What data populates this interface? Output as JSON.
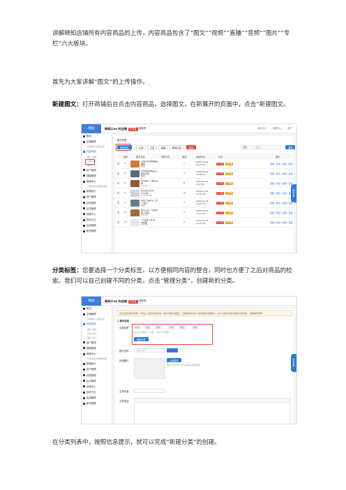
{
  "doc": {
    "p1": "讲解晓知店铺所有内容商品的上传，内容商品包含了“图文”“视频”“直播”“音频”“图片”“专栏”六大板块。",
    "p2": "首先为大家讲解“图文”的上传操作。",
    "p3_bold": "新建图文：",
    "p3": "打开商铺后台点击内容商品，选择图文，在新展开的页面中，点击“新建图文。",
    "p4_bold": "分类标签：",
    "p4": "您要选择一个分类标签，以方便相同内容的整合，同时也方便了之后对商品的检索。我们可以自己创建不同的分类，点击“管理分类”，创建新的分类。",
    "p5": "在分类列表中，按照信息提示，就可以完成“新建分类”的创建。"
  },
  "shot1": {
    "logo": "晓知",
    "shop": "晓知Live 的店铺",
    "tag": "已认证",
    "topmid": "店铺管理",
    "topright": [
      "消息中心",
      "帮助中心",
      "账户"
    ],
    "sidebar": [
      {
        "label": "概况",
        "type": "main"
      },
      {
        "label": "店铺管理",
        "type": "main"
      },
      {
        "label": "店铺装修  店铺设置",
        "type": "sub"
      },
      {
        "label": "内容商品",
        "type": "on"
      },
      {
        "label": "图文   视频",
        "type": "sub"
      },
      {
        "label": "直播   音频",
        "type": "sub"
      },
      {
        "label": "图册   专栏",
        "type": "sub"
      },
      {
        "label": "用户管理",
        "type": "main"
      },
      {
        "label": "课程管理",
        "type": "main"
      },
      {
        "label": "营销中心",
        "type": "main"
      },
      {
        "label": "订单管理  优惠券管理",
        "type": "sub"
      },
      {
        "label": "数据统计",
        "type": "main"
      },
      {
        "label": "用户管理",
        "type": "main"
      },
      {
        "label": "绩效管理",
        "type": "main"
      },
      {
        "label": "会员管理",
        "type": "main"
      },
      {
        "label": "资源中心",
        "type": "main"
      },
      {
        "label": "操作日志",
        "type": "main"
      },
      {
        "label": "应用管理",
        "type": "main"
      },
      {
        "label": "账号管理",
        "type": "main"
      }
    ],
    "crumb": "图文列表",
    "buttons": [
      "新建图文",
      "上架",
      "下架",
      "隐藏",
      "移动分类",
      "删除"
    ],
    "search_select": "名称",
    "search_placeholder": "请输入",
    "search_btn": "搜索",
    "columns": [
      "排序",
      "图文信息",
      "所属专栏",
      "销量",
      "创建时间",
      "状态",
      "操作"
    ],
    "rows": [
      {
        "no": "3",
        "title": "点播签到课程精品福利...",
        "price": "免费",
        "sales": "3",
        "date": "2020-05-20 09:33:15",
        "color": "#c97b3c"
      },
      {
        "no": "3",
        "title": "晓知精品课程自己赶紧说说",
        "price": "免费",
        "sales": "3",
        "date": "2020-05-20 15:56:13",
        "color": "#5a6a7a"
      },
      {
        "no": "3",
        "title": "如何提升，做好自律",
        "price": "¥ 9.90",
        "sales": "8",
        "date": "2020-03-29 9:52:52",
        "color": "#8b5a3c"
      },
      {
        "no": "5",
        "title": "如何成为优秀、2020年...",
        "price": "¥ 2020.00",
        "sales": "11",
        "date": "2020-12-26 10:31:46",
        "color": "#d0d4d8"
      },
      {
        "no": "6",
        "title": "如何产品并带工作一项合...",
        "price": "免费",
        "sales": "3",
        "date": "2020-02-18 10:07:53",
        "color": "#6a7b8c"
      },
      {
        "no": "12",
        "title": "如何写好（专项篇精心排版...",
        "price": "¥ 9.90",
        "sales": "3",
        "date": "2020-02-28 10:18:11",
        "color": "#a3673c"
      },
      {
        "no": "13",
        "title": "“不熬夜不秃顶、熬夜都...",
        "price": "¥ 2.90",
        "sales": "0",
        "date": "2020-02-28 10:24:33",
        "color": "#e6e8eb"
      }
    ],
    "status": [
      "已上架",
      "已隐藏"
    ],
    "ops": "查看 | 预览 | 编辑 | 更多",
    "float": "联系客服"
  },
  "shot2": {
    "logo": "晓知",
    "shop": "晓知Live 的店铺",
    "tag": "已认证",
    "topmid": "店铺管理",
    "notice": "建议使用谷歌浏览器，可防止上传时出现异常；建议尽量压缩图片，正确选择标签可以获得更多流量曝光，在平台发布内容请遵守法律法规。 查看规则说明",
    "section": "1 基本信息",
    "category_label": "分类标签",
    "chips": [
      "标签",
      "标签",
      "标签",
      "标签",
      "标签",
      "标签"
    ],
    "hint": "您还可以添加3个分类，请在下方选择",
    "manage": "管理分类",
    "name_label": "图文名称",
    "name_placeholder": "请输入名称",
    "cover_label": "封面图片",
    "upload": "上传图片",
    "cover_hint": "建议上传750*560px的JPG格式图片",
    "author_label": "文章作者",
    "content_label": "文章内容",
    "float": "联系客服"
  },
  "colors": {
    "accent": "#2f7ad8",
    "highlight": "#e8453c"
  }
}
